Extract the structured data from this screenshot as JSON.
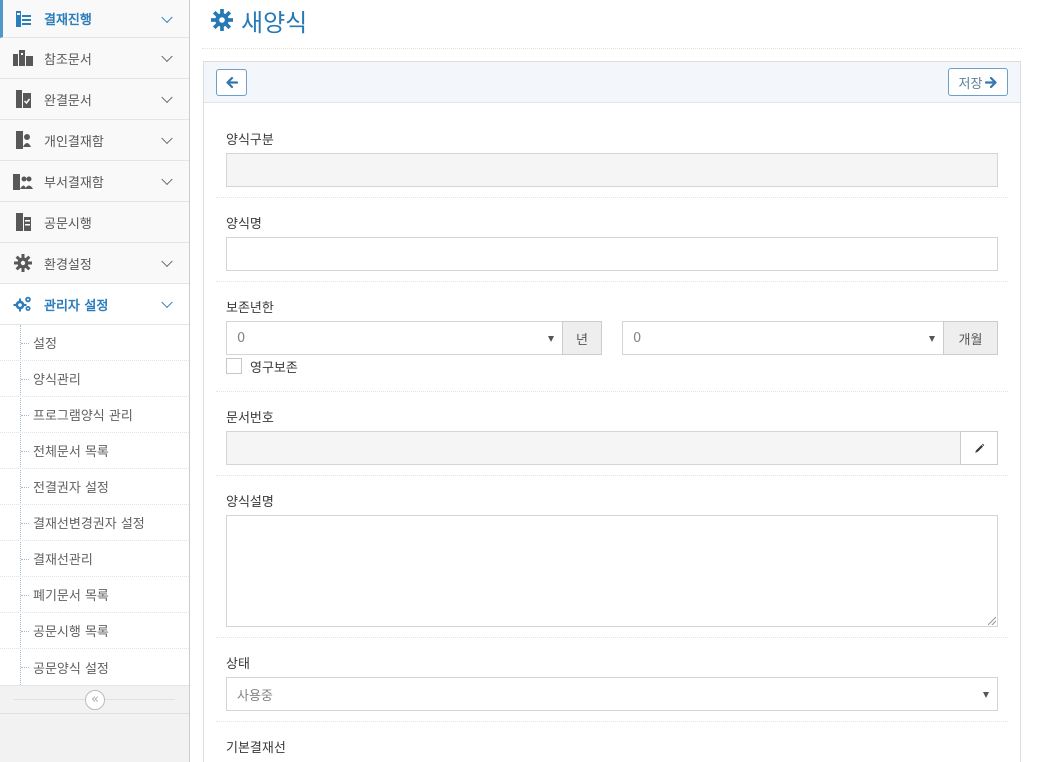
{
  "sidebar": {
    "items": [
      {
        "label": "결재진행",
        "icon": "approval-progress-icon"
      },
      {
        "label": "참조문서",
        "icon": "reference-docs-icon"
      },
      {
        "label": "완결문서",
        "icon": "completed-docs-icon"
      },
      {
        "label": "개인결재함",
        "icon": "personal-approval-box-icon"
      },
      {
        "label": "부서결재함",
        "icon": "department-approval-box-icon"
      },
      {
        "label": "공문시행",
        "icon": "official-document-icon"
      },
      {
        "label": "환경설정",
        "icon": "gear-icon"
      },
      {
        "label": "관리자 설정",
        "icon": "cogs-icon"
      }
    ],
    "submenu": [
      "설정",
      "양식관리",
      "프로그램양식 관리",
      "전체문서 목록",
      "전결권자 설정",
      "결재선변경권자 설정",
      "결재선관리",
      "폐기문서 목록",
      "공문시행 목록",
      "공문양식 설정"
    ],
    "collapse_icon": "«"
  },
  "header": {
    "title": "새양식",
    "icon": "gear-icon",
    "accent": "#2679b5"
  },
  "toolbar": {
    "save_label": "저장"
  },
  "form": {
    "type_label": "양식구분",
    "name_label": "양식명",
    "retention_label": "보존년한",
    "retention_years_value": "0",
    "retention_years_unit": "년",
    "retention_months_value": "0",
    "retention_months_unit": "개월",
    "permanent_label": "영구보존",
    "docnum_label": "문서번호",
    "desc_label": "양식설명",
    "status_label": "상태",
    "status_value": "사용중",
    "default_line_label": "기본결재선"
  }
}
